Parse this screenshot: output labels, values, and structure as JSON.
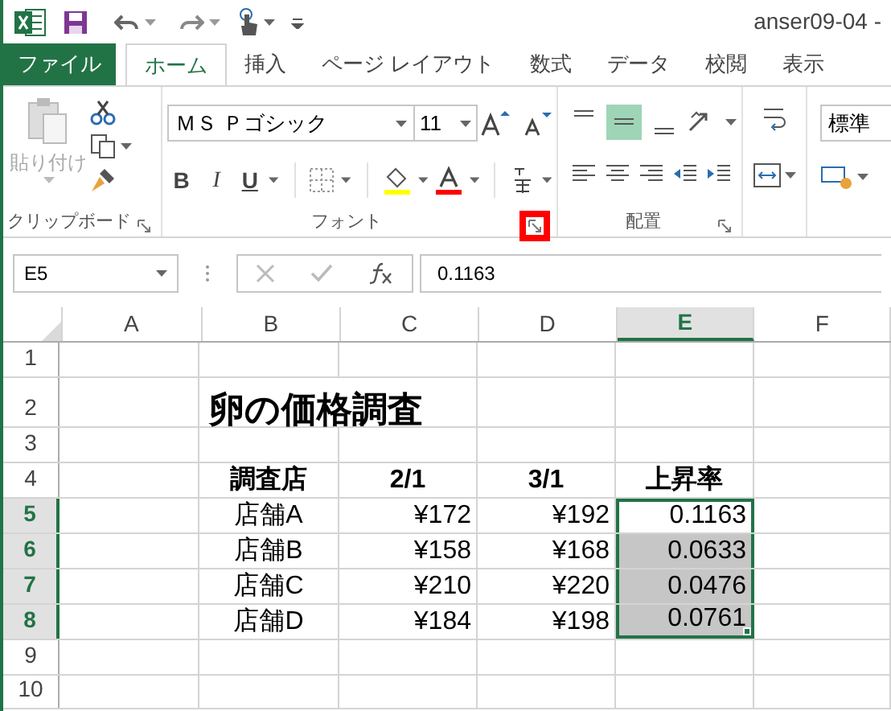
{
  "window": {
    "title": "anser09-04 -"
  },
  "tabs": [
    {
      "label": "ファイル",
      "kind": "file",
      "selected": false
    },
    {
      "label": "ホーム",
      "kind": "tab",
      "selected": true
    },
    {
      "label": "挿入",
      "kind": "tab",
      "selected": false
    },
    {
      "label": "ページ レイアウト",
      "kind": "tab",
      "selected": false
    },
    {
      "label": "数式",
      "kind": "tab",
      "selected": false
    },
    {
      "label": "データ",
      "kind": "tab",
      "selected": false
    },
    {
      "label": "校閲",
      "kind": "tab",
      "selected": false
    },
    {
      "label": "表示",
      "kind": "tab",
      "selected": false
    }
  ],
  "ribbon": {
    "paste_label": "貼り付け",
    "font_name": "ＭＳ Ｐゴシック",
    "font_size": "11",
    "bold": "B",
    "italic": "I",
    "underline": "U",
    "number_format": "標準",
    "groups": [
      {
        "label": "クリップボード",
        "highlighted": false
      },
      {
        "label": "フォント",
        "highlighted": true
      },
      {
        "label": "配置",
        "highlighted": false
      }
    ]
  },
  "formula_bar": {
    "name_box": "E5",
    "value": "0.1163"
  },
  "columns": [
    {
      "label": "A",
      "selected": false
    },
    {
      "label": "B",
      "selected": false
    },
    {
      "label": "C",
      "selected": false
    },
    {
      "label": "D",
      "selected": false
    },
    {
      "label": "E",
      "selected": true
    },
    {
      "label": "F",
      "selected": false
    }
  ],
  "rows": [
    {
      "label": "1",
      "selected": false,
      "cells": [
        {
          "selected": false,
          "active": false
        },
        {
          "selected": false,
          "active": false
        },
        {
          "selected": false,
          "active": false
        },
        {
          "selected": false,
          "active": false
        },
        {
          "selected": false,
          "active": false
        },
        {
          "selected": false,
          "active": false
        }
      ]
    },
    {
      "label": "2",
      "selected": false,
      "cells": [
        {
          "selected": false,
          "active": false
        },
        {
          "text": "卵の価格調査",
          "kind": "title",
          "selected": false,
          "active": false
        },
        {
          "selected": false,
          "active": false
        },
        {
          "selected": false,
          "active": false
        },
        {
          "selected": false,
          "active": false
        },
        {
          "selected": false,
          "active": false
        }
      ]
    },
    {
      "label": "3",
      "selected": false,
      "cells": [
        {
          "selected": false,
          "active": false
        },
        {
          "selected": false,
          "active": false
        },
        {
          "selected": false,
          "active": false
        },
        {
          "selected": false,
          "active": false
        },
        {
          "selected": false,
          "active": false
        },
        {
          "selected": false,
          "active": false
        }
      ]
    },
    {
      "label": "4",
      "selected": false,
      "cells": [
        {
          "selected": false,
          "active": false
        },
        {
          "text": "調査店",
          "kind": "header",
          "selected": false,
          "active": false
        },
        {
          "text": "2/1",
          "kind": "header",
          "selected": false,
          "active": false
        },
        {
          "text": "3/1",
          "kind": "header",
          "selected": false,
          "active": false
        },
        {
          "text": "上昇率",
          "kind": "header",
          "selected": false,
          "active": false
        },
        {
          "selected": false,
          "active": false
        }
      ]
    },
    {
      "label": "5",
      "selected": true,
      "cells": [
        {
          "selected": false,
          "active": false
        },
        {
          "text": "店舗A",
          "kind": "text",
          "selected": false,
          "active": false
        },
        {
          "text": "¥172",
          "kind": "number",
          "selected": false,
          "active": false
        },
        {
          "text": "¥192",
          "kind": "number",
          "selected": false,
          "active": false
        },
        {
          "text": "0.1163",
          "kind": "number",
          "selected": true,
          "active": true
        },
        {
          "selected": false,
          "active": false
        }
      ]
    },
    {
      "label": "6",
      "selected": true,
      "cells": [
        {
          "selected": false,
          "active": false
        },
        {
          "text": "店舗B",
          "kind": "text",
          "selected": false,
          "active": false
        },
        {
          "text": "¥158",
          "kind": "number",
          "selected": false,
          "active": false
        },
        {
          "text": "¥168",
          "kind": "number",
          "selected": false,
          "active": false
        },
        {
          "text": "0.0633",
          "kind": "number",
          "selected": true,
          "active": false
        },
        {
          "selected": false,
          "active": false
        }
      ]
    },
    {
      "label": "7",
      "selected": true,
      "cells": [
        {
          "selected": false,
          "active": false
        },
        {
          "text": "店舗C",
          "kind": "text",
          "selected": false,
          "active": false
        },
        {
          "text": "¥210",
          "kind": "number",
          "selected": false,
          "active": false
        },
        {
          "text": "¥220",
          "kind": "number",
          "selected": false,
          "active": false
        },
        {
          "text": "0.0476",
          "kind": "number",
          "selected": true,
          "active": false
        },
        {
          "selected": false,
          "active": false
        }
      ]
    },
    {
      "label": "8",
      "selected": true,
      "cells": [
        {
          "selected": false,
          "active": false
        },
        {
          "text": "店舗D",
          "kind": "text",
          "selected": false,
          "active": false
        },
        {
          "text": "¥184",
          "kind": "number",
          "selected": false,
          "active": false
        },
        {
          "text": "¥198",
          "kind": "number",
          "selected": false,
          "active": false
        },
        {
          "text": "0.0761",
          "kind": "number",
          "selected": true,
          "active": false
        },
        {
          "selected": false,
          "active": false
        }
      ]
    },
    {
      "label": "9",
      "selected": false,
      "cells": [
        {
          "selected": false,
          "active": false
        },
        {
          "selected": false,
          "active": false
        },
        {
          "selected": false,
          "active": false
        },
        {
          "selected": false,
          "active": false
        },
        {
          "selected": false,
          "active": false
        },
        {
          "selected": false,
          "active": false
        }
      ]
    },
    {
      "label": "10",
      "selected": false,
      "cells": [
        {
          "selected": false,
          "active": false
        },
        {
          "selected": false,
          "active": false
        },
        {
          "selected": false,
          "active": false
        },
        {
          "selected": false,
          "active": false
        },
        {
          "selected": false,
          "active": false
        },
        {
          "selected": false,
          "active": false
        }
      ]
    }
  ]
}
